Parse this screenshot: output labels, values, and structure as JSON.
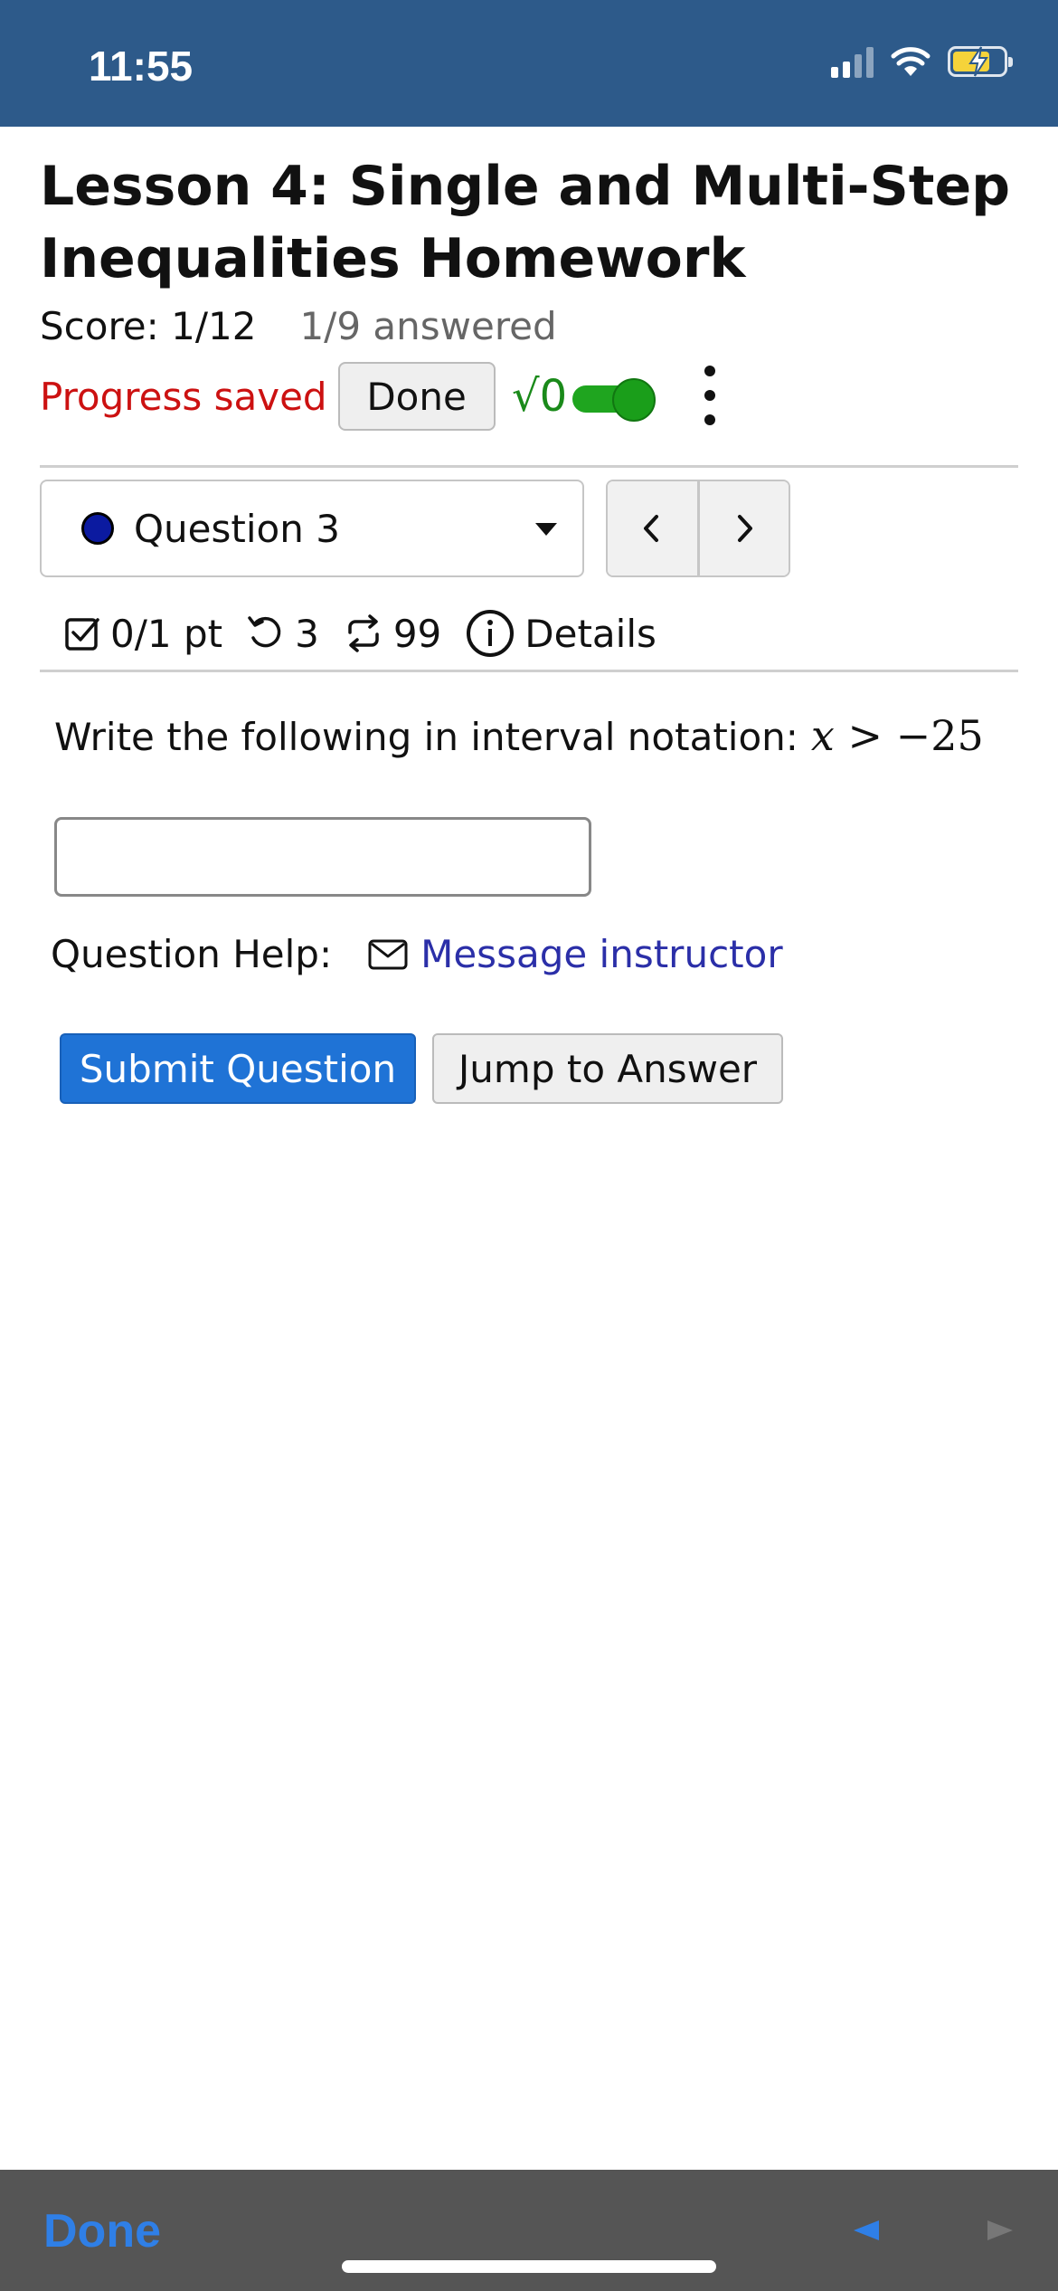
{
  "status_bar": {
    "time": "11:55",
    "icons": [
      "cellular-signal-icon",
      "wifi-icon",
      "battery-charging-icon"
    ],
    "background": "#2d5a8a"
  },
  "header": {
    "title": "Lesson 4: Single and Multi-Step Inequalities Homework",
    "score": "Score: 1/12",
    "answered": "1/9 answered",
    "progress_saved": "Progress saved",
    "done_label": "Done",
    "math_toggle_label": "√0",
    "math_toggle_on": true
  },
  "question_nav": {
    "selected": "Question 3",
    "status_color": "#0b1aa0",
    "prev_icon": "chevron-left-icon",
    "next_icon": "chevron-right-icon"
  },
  "meta": {
    "points": "0/1 pt",
    "attempts": "3",
    "regenerations": "99",
    "details_label": "Details"
  },
  "question": {
    "prompt": "Write the following in interval notation:",
    "expr_var": "x",
    "expr_op": ">",
    "expr_value": "−25",
    "answer_value": ""
  },
  "help": {
    "label": "Question Help:",
    "message_label": "Message instructor"
  },
  "actions": {
    "submit_label": "Submit Question",
    "jump_label": "Jump to Answer"
  },
  "bottom_toolbar": {
    "done_label": "Done",
    "accent": "#2f7fe6"
  }
}
